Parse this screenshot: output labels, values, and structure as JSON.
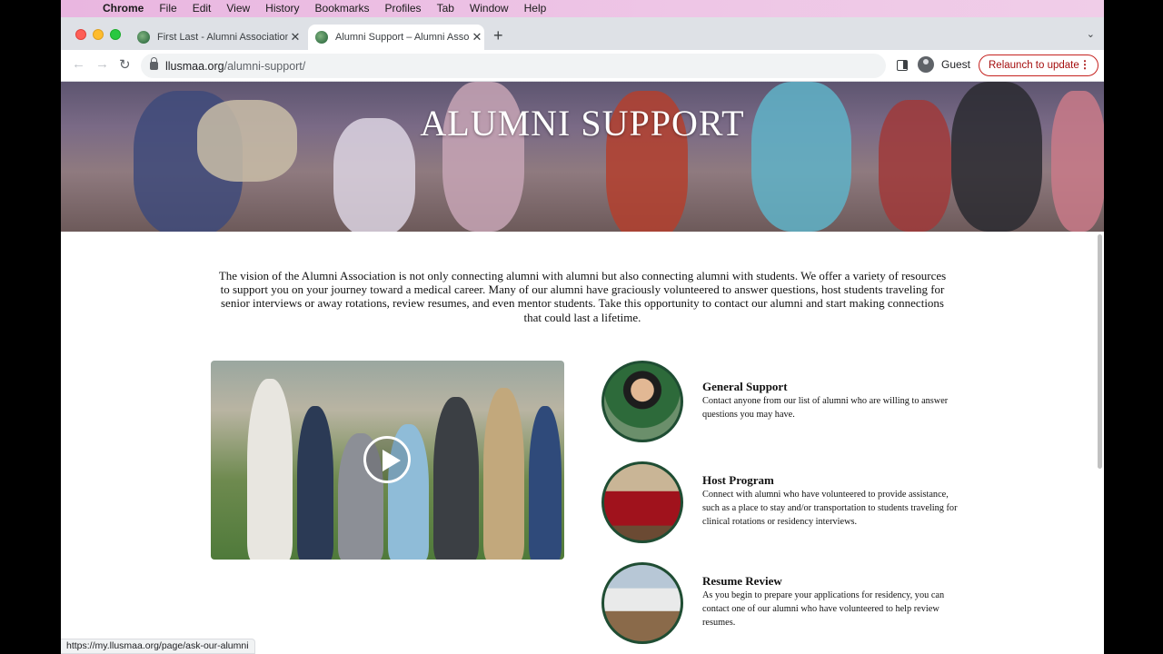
{
  "menubar": {
    "app": "Chrome",
    "items": [
      "File",
      "Edit",
      "View",
      "History",
      "Bookmarks",
      "Profiles",
      "Tab",
      "Window",
      "Help"
    ]
  },
  "tabs": [
    {
      "title": "First Last - Alumni Association",
      "active": false
    },
    {
      "title": "Alumni Support – Alumni Asso",
      "active": true
    }
  ],
  "toolbar": {
    "url_host": "llusmaa.org",
    "url_path": "/alumni-support/",
    "profile_label": "Guest",
    "relaunch_label": "Relaunch to update"
  },
  "page": {
    "hero_title": "ALUMNI SUPPORT",
    "intro": "The vision of the Alumni Association is not only connecting alumni with alumni but also connecting alumni with students. We offer a variety of resources to support you on your journey toward a medical career. Many of our alumni have graciously volunteered to answer questions, host students traveling for senior interviews or away rotations, review resumes, and even mentor students. Take this opportunity to contact our alumni and start making connections that could last a lifetime.",
    "features": [
      {
        "title": "General Support",
        "desc": "Contact anyone from our list of alumni who are willing to answer questions you may have."
      },
      {
        "title": "Host Program",
        "desc": "Connect with alumni who have volunteered to provide assistance, such as a place to stay and/or transportation to students traveling for clinical rotations or residency interviews."
      },
      {
        "title": "Resume Review",
        "desc": "As you begin to prepare your applications for residency, you can contact one of our alumni who have volunteered to help review resumes."
      }
    ]
  },
  "status_url": "https://my.llusmaa.org/page/ask-our-alumni",
  "colors": {
    "accent_green": "#1f4d33",
    "relaunch_red": "#c5221f"
  }
}
